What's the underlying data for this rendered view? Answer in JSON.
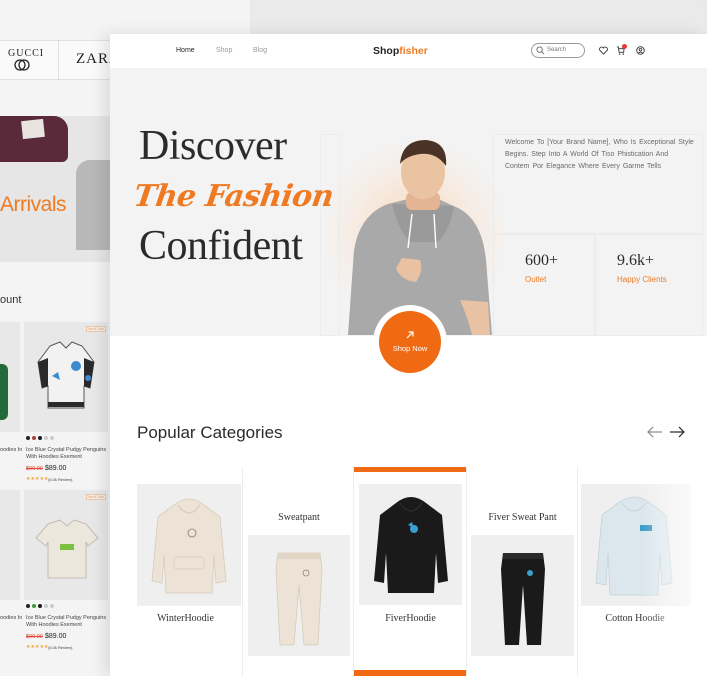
{
  "background_page": {
    "brands": [
      "GUCCI",
      "ZARA"
    ],
    "hero_text": "Arrivals",
    "section_fragment": "ount",
    "cards": [
      {
        "badge": "Trend Sale",
        "name": "Ice Blue Crystal Pudgy Penguins With Hoodies Exement",
        "old_price": "$99.00",
        "price": "$89.00",
        "reviews": "(5.0k Review)",
        "left_fragment": "oodies In"
      },
      {
        "badge": "Trend Sale",
        "name": "Ice Blue Crystal Pudgy Penguins With Hoodies Exement",
        "old_price": "$99.00",
        "price": "$89.00",
        "reviews": "(5.0k Review)",
        "left_fragment": "oodies In"
      }
    ],
    "stars": "★★★★★"
  },
  "nav": {
    "links": [
      {
        "label": "Home",
        "active": true
      },
      {
        "label": "Shop",
        "active": false
      },
      {
        "label": "Blog",
        "active": false
      }
    ],
    "logo_main": "Shop",
    "logo_accent": "fisher",
    "search_placeholder": "Search",
    "icons": [
      "search-icon",
      "heart-icon",
      "cart-icon",
      "user-icon"
    ]
  },
  "hero": {
    "line1": "Discover",
    "line2": "The Fashion",
    "line3": "Confident",
    "welcome": "Welcome  To [Your Brand Name], Who Is  Exceptional Style Begins. Step Into A   World Of   Tiso Phistication And Contem Por Elegance Where   Every Garme Tells",
    "stats": [
      {
        "value": "600+",
        "label": "Outlet"
      },
      {
        "value": "9.6k+",
        "label": "Happy Clients"
      }
    ],
    "cta": "Shop Now"
  },
  "categories": {
    "title": "Popular Categories",
    "items": [
      {
        "name": "WinterHoodie",
        "color": "#ece3d6"
      },
      {
        "name": "Sweatpant",
        "color": "#ece3d6"
      },
      {
        "name": "FiverHoodie",
        "color": "#1a1a1a"
      },
      {
        "name": "Fiver Sweat Pant",
        "color": "#1a1a1a"
      },
      {
        "name": "Cotton Hoodie",
        "color": "#dbe7ec"
      }
    ]
  },
  "colors": {
    "accent": "#ef6a12",
    "text": "#2b2b2b"
  }
}
